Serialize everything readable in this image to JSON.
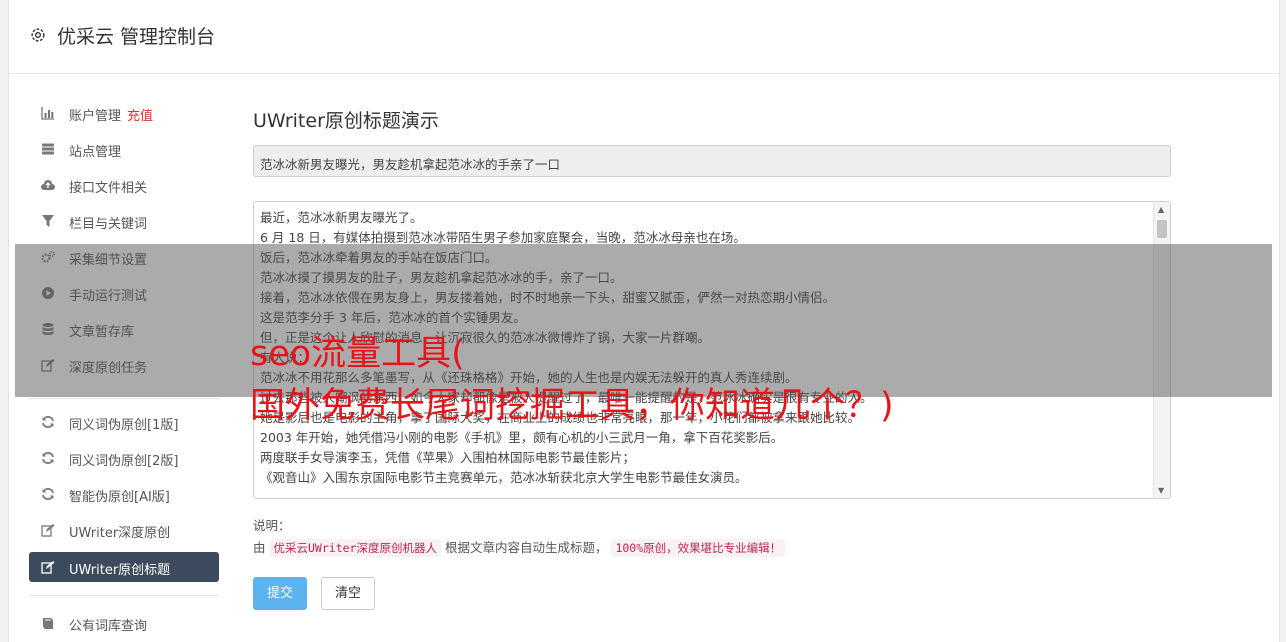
{
  "header": {
    "title": "优采云 管理控制台",
    "icon": "gear-icon"
  },
  "sidebar": {
    "items": [
      {
        "label": "账户管理",
        "extra": "充值",
        "icon": "bar-chart-icon"
      },
      {
        "label": "站点管理",
        "icon": "server-icon"
      },
      {
        "label": "接口文件相关",
        "icon": "cloud-upload-icon"
      },
      {
        "label": "栏目与关键词",
        "icon": "filter-icon"
      },
      {
        "label": "采集细节设置",
        "icon": "gears-icon"
      },
      {
        "label": "手动运行测试",
        "icon": "play-circle-icon"
      },
      {
        "label": "文章暂存库",
        "icon": "database-icon"
      },
      {
        "label": "深度原创任务",
        "icon": "edit-icon"
      },
      {
        "label": "同义词伪原创[1版]",
        "icon": "refresh-icon"
      },
      {
        "label": "同义词伪原创[2版]",
        "icon": "refresh-icon"
      },
      {
        "label": "智能伪原创[AI版]",
        "icon": "refresh-icon"
      },
      {
        "label": "UWriter深度原创",
        "icon": "edit-icon"
      },
      {
        "label": "UWriter原创标题",
        "icon": "edit-icon",
        "active": true
      },
      {
        "label": "公有词库查询",
        "icon": "book-icon"
      }
    ]
  },
  "main": {
    "form_title": "UWriter原创标题演示",
    "title_input_value": "范冰冰新男友曝光，男友趁机拿起范冰冰的手亲了一口",
    "content_lines": [
      "最近，范冰冰新男友曝光了。",
      "6 月 18 日，有媒体拍摄到范冰冰带陌生男子参加家庭聚会，当晚，范冰冰母亲也在场。",
      "饭后，范冰冰牵着男友的手站在饭店门口。",
      "范冰冰摸了摸男友的肚子，男友趁机拿起范冰冰的手，亲了一口。",
      "接着，范冰冰依偎在男友身上，男友搂着她，时不时地亲一下头，甜蜜又腻歪，俨然一对热恋期小情侣。",
      "这是范李分手 3 年后，范冰冰的首个实锤男友。",
      "但，正是这个让人欣慰的消息，让沉寂很久的范冰冰微博炸了锅，大家一片群嘲。",
      "有人说：",
      "范冰冰不用花那么多笔墨写，从《还珠格格》开始，她的人生也是内娱无法躲开的真人秀连续剧。",
      "过去那些被人嘲讽的东西，如今大家却都像是被人提醒过了，最唯一能提醒的是，范冰冰确实是很有专业的人。",
      "她是影后也是电影的主角，拿了国际大奖，在商业上的成绩也非常亮眼，那一年，小花们都被拿来跟她比较。",
      "2003 年开始，她凭借冯小刚的电影《手机》里，颇有心机的小三武月一角，拿下百花奖影后。",
      "两度联手女导演李玉，凭借《苹果》入围柏林国际电影节最佳影片；",
      "《观音山》入围东京国际电影节主竞赛单元，范冰冰斩获北京大学生电影节最佳女演员。"
    ],
    "note_label": "说明：",
    "note_prefix": "由",
    "note_tag1": "优采云UWriter深度原创机器人",
    "note_mid": "根据文章内容自动生成标题，",
    "note_tag2": "100%原创，效果堪比专业编辑！",
    "submit_label": "提交",
    "clear_label": "清空"
  },
  "overlay": {
    "line1": "seo流量工具(",
    "line2": "国外免费长尾词挖掘工具，你知道几个？)"
  },
  "colors": {
    "accent": "#5bb3f0",
    "active_nav": "#3c4a5e",
    "highlight": "#d9352a",
    "overlay_text": "#e8141a"
  }
}
